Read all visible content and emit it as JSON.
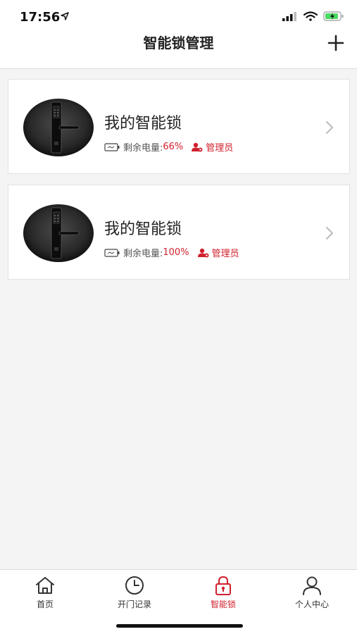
{
  "status_bar": {
    "time": "17:56"
  },
  "nav": {
    "title": "智能锁管理"
  },
  "locks": [
    {
      "name": "我的智能锁",
      "battery_label": "剩余电量:",
      "battery_value": "66%",
      "role": "管理员"
    },
    {
      "name": "我的智能锁",
      "battery_label": "剩余电量:",
      "battery_value": "100%",
      "role": "管理员"
    }
  ],
  "tabs": [
    {
      "label": "首页",
      "icon": "home-icon",
      "active": false
    },
    {
      "label": "开门记录",
      "icon": "clock-icon",
      "active": false
    },
    {
      "label": "智能锁",
      "icon": "lock-icon",
      "active": true
    },
    {
      "label": "个人中心",
      "icon": "person-icon",
      "active": false
    }
  ],
  "colors": {
    "accent": "#d0202d",
    "background": "#f4f4f4"
  }
}
